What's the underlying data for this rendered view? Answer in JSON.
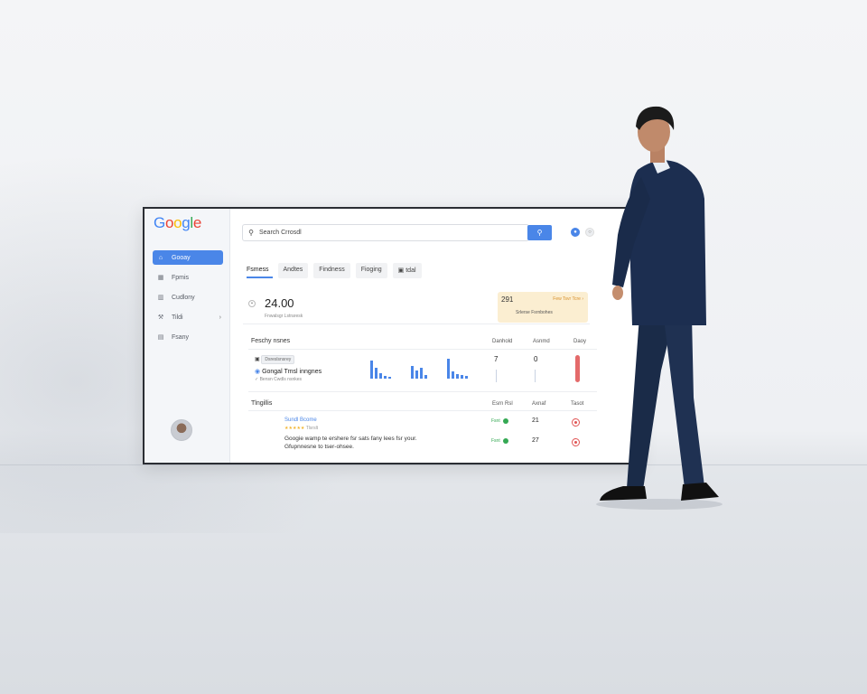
{
  "logo": {
    "letters": [
      "G",
      "o",
      "o",
      "g",
      "l",
      "e"
    ],
    "colors": [
      "#4285F4",
      "#EA4335",
      "#FBBC05",
      "#4285F4",
      "#34A853",
      "#EA4335"
    ]
  },
  "sidebar": {
    "items": [
      {
        "label": "Gooay",
        "icon": "home-icon",
        "active": true
      },
      {
        "label": "Fpmis",
        "icon": "grid-icon"
      },
      {
        "label": "Cudlony",
        "icon": "chart-icon"
      },
      {
        "label": "Tildi",
        "icon": "wrench-icon",
        "has_chevron": true
      },
      {
        "label": "Fsany",
        "icon": "document-icon"
      }
    ]
  },
  "search": {
    "placeholder": "Search Crrosdl",
    "button_icon": "search-icon"
  },
  "top_icons": [
    "account-icon",
    "settings-icon"
  ],
  "tabs": [
    {
      "label": "Fsmess",
      "active": true
    },
    {
      "label": "Andtes"
    },
    {
      "label": "Findness"
    },
    {
      "label": "Fioging"
    },
    {
      "label": "tdal"
    }
  ],
  "stat": {
    "value": "24.00",
    "caption": "Fnwalsgr Lstraresk"
  },
  "promo": {
    "number": "291",
    "link": "Few Tsvr Tcre ›",
    "text": "Srlerse Fsrnbohes"
  },
  "ranking": {
    "title": "Feschy nsnes",
    "columns": [
      "Danhold",
      "Asnmd",
      "Daoy"
    ],
    "rows": [
      {
        "tag": "Dsreslsnsrey",
        "label": "Gongal Tmsl inngnes",
        "sub": "Bensn Cwdls nsnkes",
        "v1": "7",
        "v2": "0"
      }
    ]
  },
  "reviews": {
    "title": "Tlngillis",
    "columns": [
      "Esrn Rsl",
      "Axnaf",
      "Tasot"
    ],
    "reviewer": "Sundl Bcome",
    "stars": "★★★★★",
    "stars_note": "Tlsrslt",
    "text": "Googie wamp te ershere fsr sats fany lees fsr your. Gfupnnesne to tser-ohsee.",
    "rows": [
      {
        "status": "Fsnt",
        "num": "21"
      },
      {
        "status": "Fsnt",
        "num": "27"
      }
    ]
  }
}
